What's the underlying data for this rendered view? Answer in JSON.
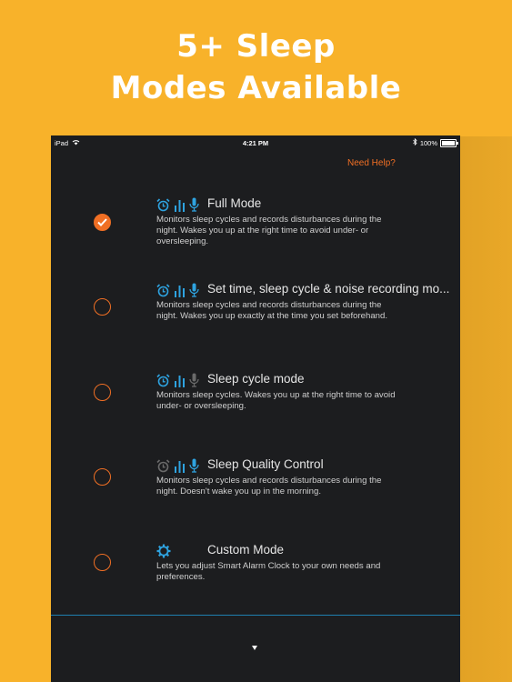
{
  "promo": {
    "line1": "5+ Sleep",
    "line2": "Modes Available"
  },
  "status": {
    "device": "iPad",
    "time": "4:21 PM",
    "battery": "100%"
  },
  "help_link": "Need Help?",
  "modes": [
    {
      "title": "Full Mode",
      "description": "Monitors sleep cycles and records disturbances during the night. Wakes you up at the right time to avoid under- or oversleeping.",
      "selected": true,
      "icons": [
        "alarm-icon",
        "sleep-cycle-icon",
        "microphone-icon"
      ]
    },
    {
      "title": "Set time, sleep cycle & noise recording mo...",
      "description": "Monitors sleep cycles and records disturbances during the night. Wakes you up exactly at the time you set beforehand.",
      "selected": false,
      "icons": [
        "alarm-icon",
        "sleep-cycle-icon",
        "microphone-icon"
      ]
    },
    {
      "title": "Sleep cycle mode",
      "description": "Monitors sleep cycles. Wakes you up at the right time to avoid under- or oversleeping.",
      "selected": false,
      "icons": [
        "alarm-icon",
        "sleep-cycle-icon",
        "microphone-icon-disabled"
      ]
    },
    {
      "title": "Sleep Quality Control",
      "description": "Monitors sleep cycles and records disturbances during the night. Doesn't wake you up in the morning.",
      "selected": false,
      "icons": [
        "alarm-icon-disabled",
        "sleep-cycle-icon",
        "microphone-icon"
      ]
    },
    {
      "title": "Custom Mode",
      "description": "Lets you adjust Smart Alarm Clock to your own needs and preferences.",
      "selected": false,
      "icons": [
        "gear-icon"
      ]
    }
  ],
  "colors": {
    "background": "#F8B22A",
    "screen": "#1C1D1F",
    "accent": "#F06F24",
    "icon_blue": "#2EA3E0",
    "icon_disabled": "#6A6A6A"
  }
}
